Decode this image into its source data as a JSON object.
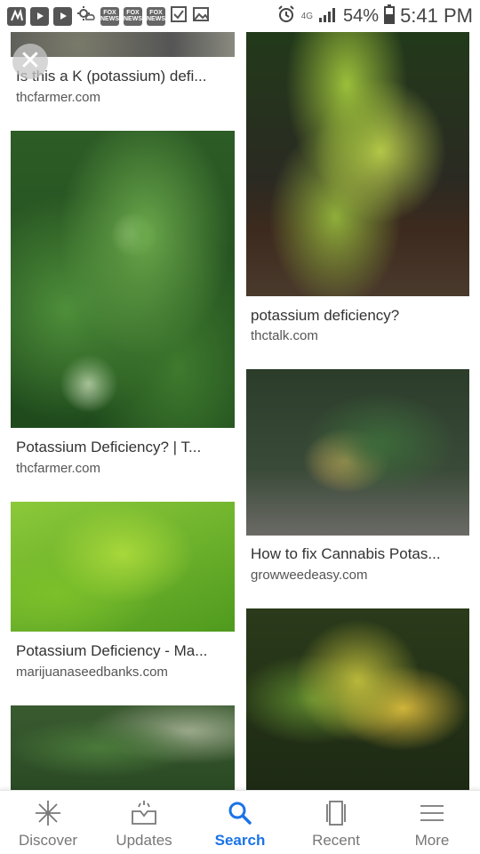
{
  "status_bar": {
    "battery_percent": "54%",
    "time": "5:41 PM",
    "network_small": "4G",
    "icons": [
      "n-app-icon",
      "youtube-icon",
      "youtube-icon",
      "weather-icon",
      "fox-news-icon",
      "fox-news-icon",
      "fox-news-icon",
      "checkbox-icon",
      "image-icon",
      "alarm-icon",
      "signal-icon",
      "battery-icon"
    ],
    "fox_label": "FOX NEWS"
  },
  "results": [
    {
      "title": "Is this a K (potassium) defi...",
      "site": "thcfarmer.com"
    },
    {
      "title": "potassium deficiency?",
      "site": "thctalk.com"
    },
    {
      "title": "Potassium Deficiency? | T...",
      "site": "thcfarmer.com"
    },
    {
      "title": "How to fix Cannabis Potas...",
      "site": "growweedeasy.com"
    },
    {
      "title": "Potassium Deficiency - Ma...",
      "site": "marijuanaseedbanks.com"
    }
  ],
  "close_glyph": "✕",
  "bottom_nav": {
    "items": [
      {
        "label": "Discover",
        "icon": "asterisk-icon"
      },
      {
        "label": "Updates",
        "icon": "inbox-icon"
      },
      {
        "label": "Search",
        "icon": "search-icon"
      },
      {
        "label": "Recent",
        "icon": "recent-icon"
      },
      {
        "label": "More",
        "icon": "menu-icon"
      }
    ],
    "active": "Search",
    "active_color": "#1a73e8"
  }
}
